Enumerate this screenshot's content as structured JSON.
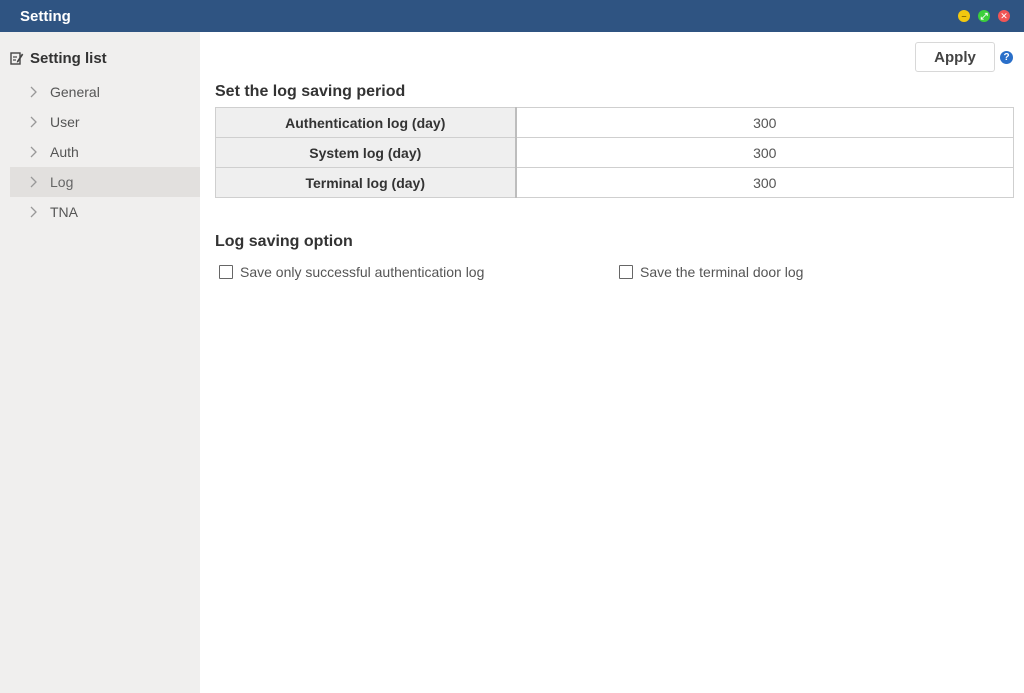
{
  "window": {
    "title": "Setting",
    "controls": {
      "minimize": "–",
      "maximize": "⤢",
      "close": "✕"
    }
  },
  "sidebar": {
    "header": "Setting list",
    "header_icon": "edit-icon",
    "items": [
      {
        "label": "General",
        "active": false
      },
      {
        "label": "User",
        "active": false
      },
      {
        "label": "Auth",
        "active": false
      },
      {
        "label": "Log",
        "active": true
      },
      {
        "label": "TNA",
        "active": false
      }
    ]
  },
  "toolbar": {
    "apply_label": "Apply",
    "help_label": "?"
  },
  "period": {
    "title": "Set the log saving period",
    "rows": [
      {
        "label": "Authentication log (day)",
        "value": "300"
      },
      {
        "label": "System log (day)",
        "value": "300"
      },
      {
        "label": "Terminal log (day)",
        "value": "300"
      }
    ]
  },
  "options": {
    "title": "Log saving option",
    "items": [
      {
        "label": "Save only successful authentication log",
        "checked": false
      },
      {
        "label": "Save the terminal door log",
        "checked": false
      }
    ]
  },
  "colors": {
    "titlebar": "#2f5482",
    "sidebar": "#f0efee",
    "sidebar_active": "#e2e0de",
    "help": "#2a6fc9"
  }
}
